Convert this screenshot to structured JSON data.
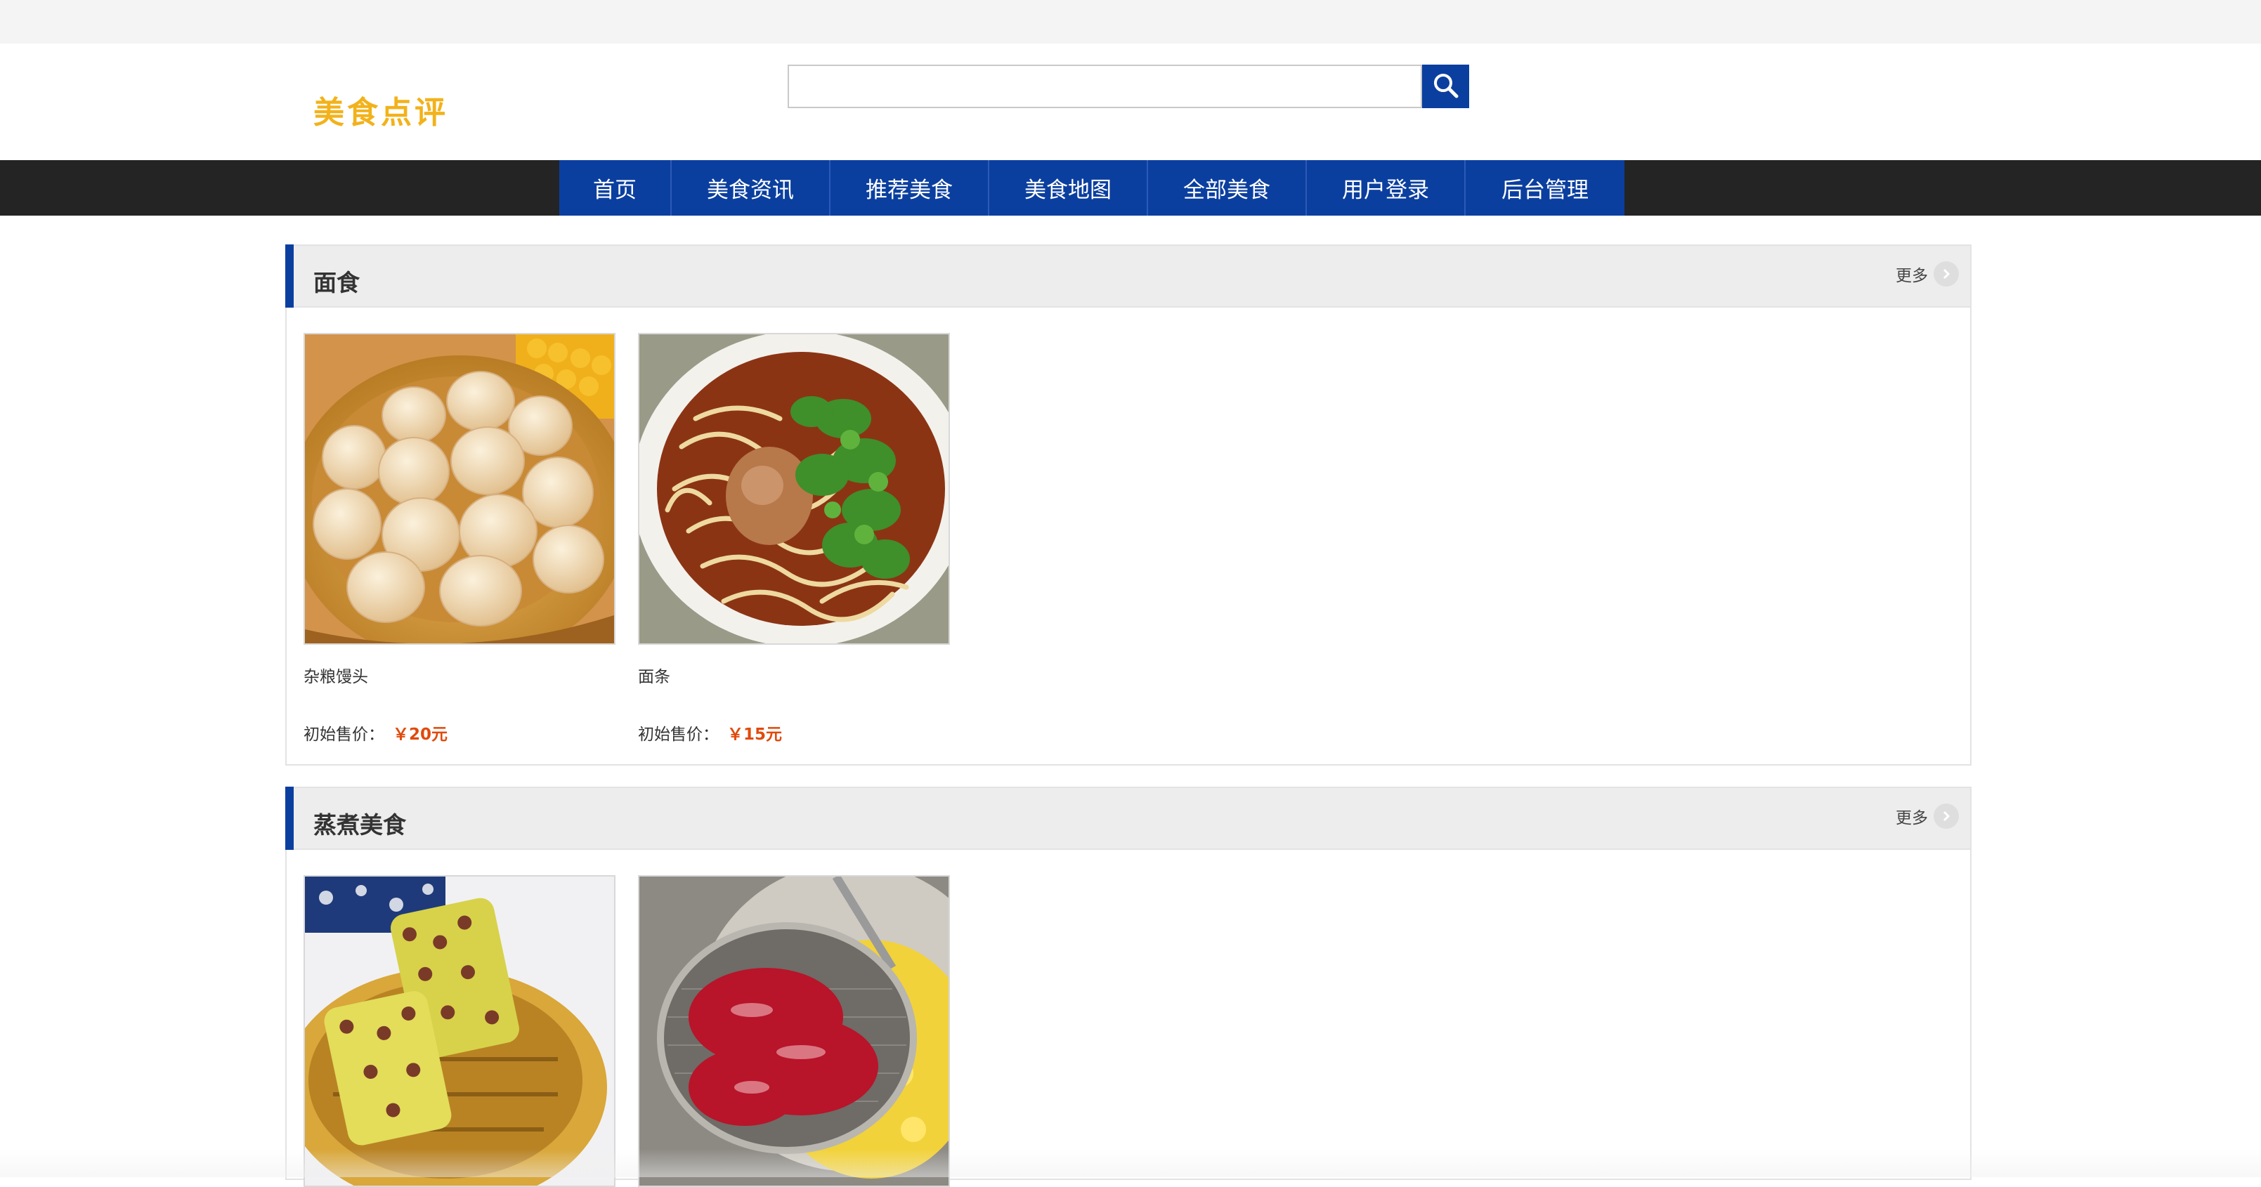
{
  "header": {
    "logo": "美食点评",
    "search": {
      "placeholder": "",
      "value": ""
    }
  },
  "nav": {
    "items": [
      {
        "label": "首页"
      },
      {
        "label": "美食资讯"
      },
      {
        "label": "推荐美食"
      },
      {
        "label": "美食地图"
      },
      {
        "label": "全部美食"
      },
      {
        "label": "用户登录"
      },
      {
        "label": "后台管理"
      }
    ]
  },
  "sections": [
    {
      "title": "面食",
      "more": "更多",
      "items": [
        {
          "name": "杂粮馒头",
          "price_label": "初始售价：",
          "price": "￥20元"
        },
        {
          "name": "面条",
          "price_label": "初始售价：",
          "price": "￥15元"
        }
      ]
    },
    {
      "title": "蒸煮美食",
      "more": "更多",
      "items": [
        {
          "name": "",
          "price_label": "",
          "price": ""
        },
        {
          "name": "",
          "price_label": "",
          "price": ""
        }
      ]
    }
  ],
  "colors": {
    "brand_blue": "#0b3f9f",
    "logo_gold": "#f2b21a",
    "price_orange": "#e04a0b",
    "nav_bar": "#242424"
  }
}
